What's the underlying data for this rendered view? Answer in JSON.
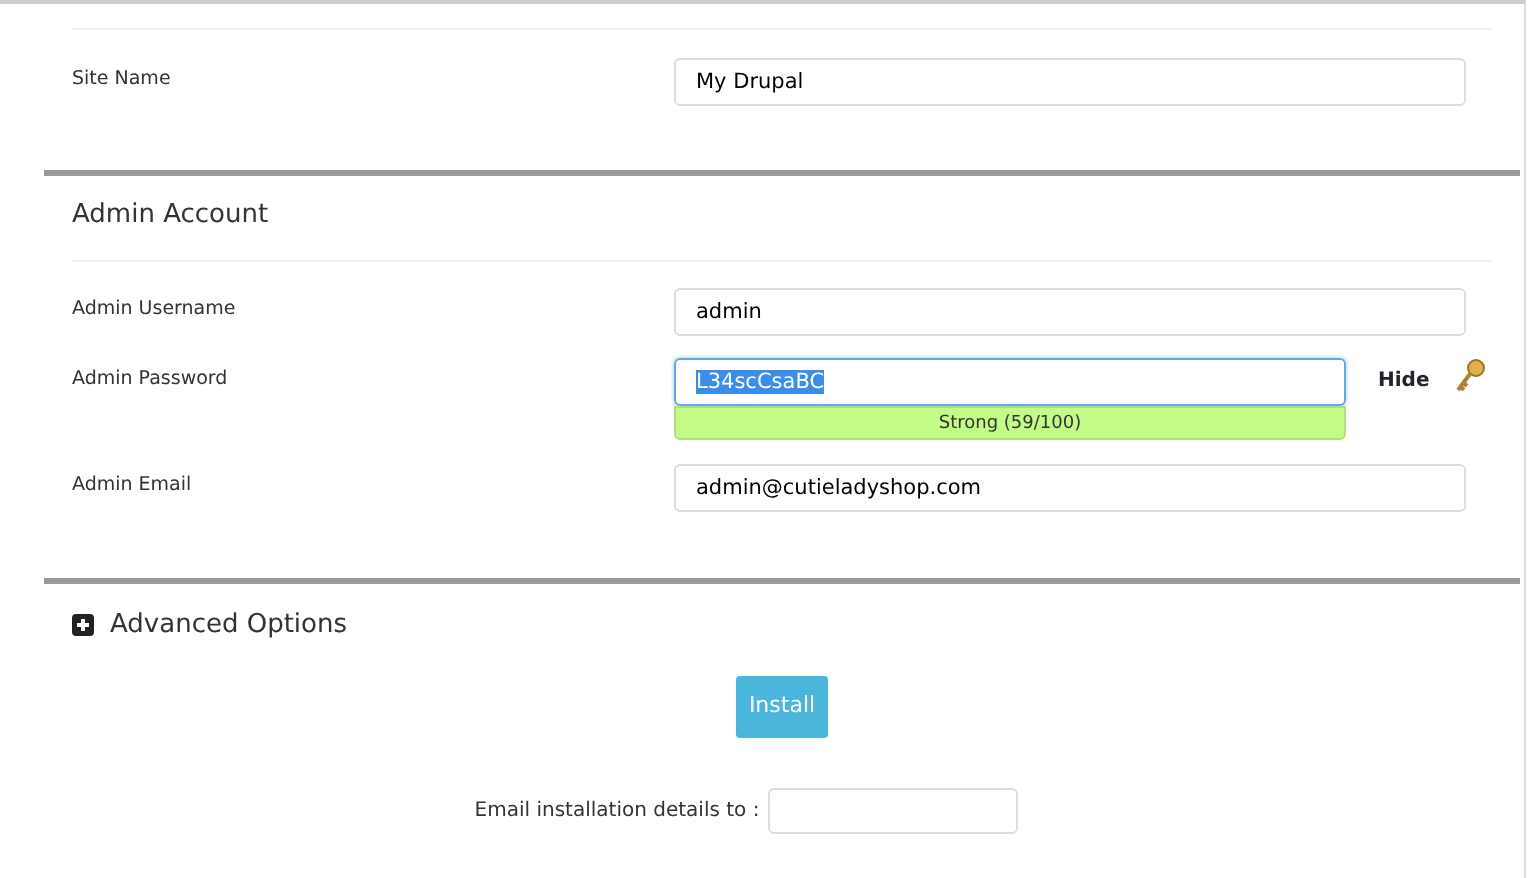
{
  "site_section": {
    "fields": [
      {
        "label": "Site Name",
        "value": "My Drupal"
      }
    ]
  },
  "admin_section": {
    "title": "Admin Account",
    "username": {
      "label": "Admin Username",
      "value": "admin"
    },
    "password": {
      "label": "Admin Password",
      "value": "L34scCsaBC",
      "focused": true,
      "text_selected": true,
      "strength": {
        "text": "Strong (59/100)"
      },
      "toggle": "Hide"
    },
    "email": {
      "label": "Admin Email",
      "value": "admin@cutieladyshop.com"
    }
  },
  "advanced": {
    "title": "Advanced Options",
    "expanded": false
  },
  "install_button": "Install",
  "email_details": {
    "label": "Email installation details to :"
  }
}
